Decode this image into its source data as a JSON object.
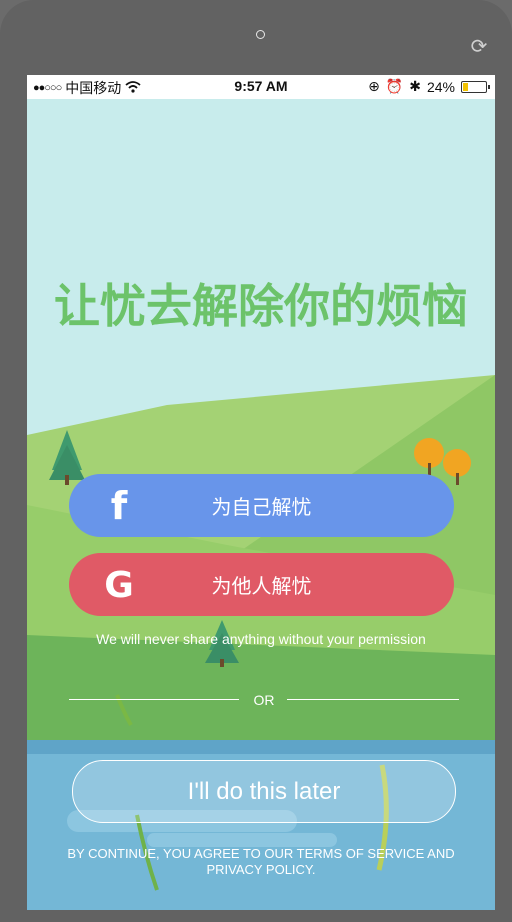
{
  "status_bar": {
    "signal": "●●○○○",
    "carrier": "中国移动",
    "time": "9:57 AM",
    "battery": "24%",
    "battery_level": 0.24
  },
  "headline": "让忧去解除你的烦恼",
  "buttons": {
    "self_label": "为自己解忧",
    "self_icon": "f",
    "others_label": "为他人解忧",
    "others_icon": "G"
  },
  "privacy_note": "We will never share anything without your permission",
  "divider_text": "OR",
  "later_label": "I'll do this later",
  "terms_text": "BY CONTINUE, YOU AGREE TO OUR TERMS OF SERVICE AND PRIVACY POLICY.",
  "colors": {
    "headline": "#6cc36a",
    "self_button": "#6895ea",
    "others_button": "#e05a66",
    "sky": "#c8ecec",
    "water": "#74b7d6"
  }
}
